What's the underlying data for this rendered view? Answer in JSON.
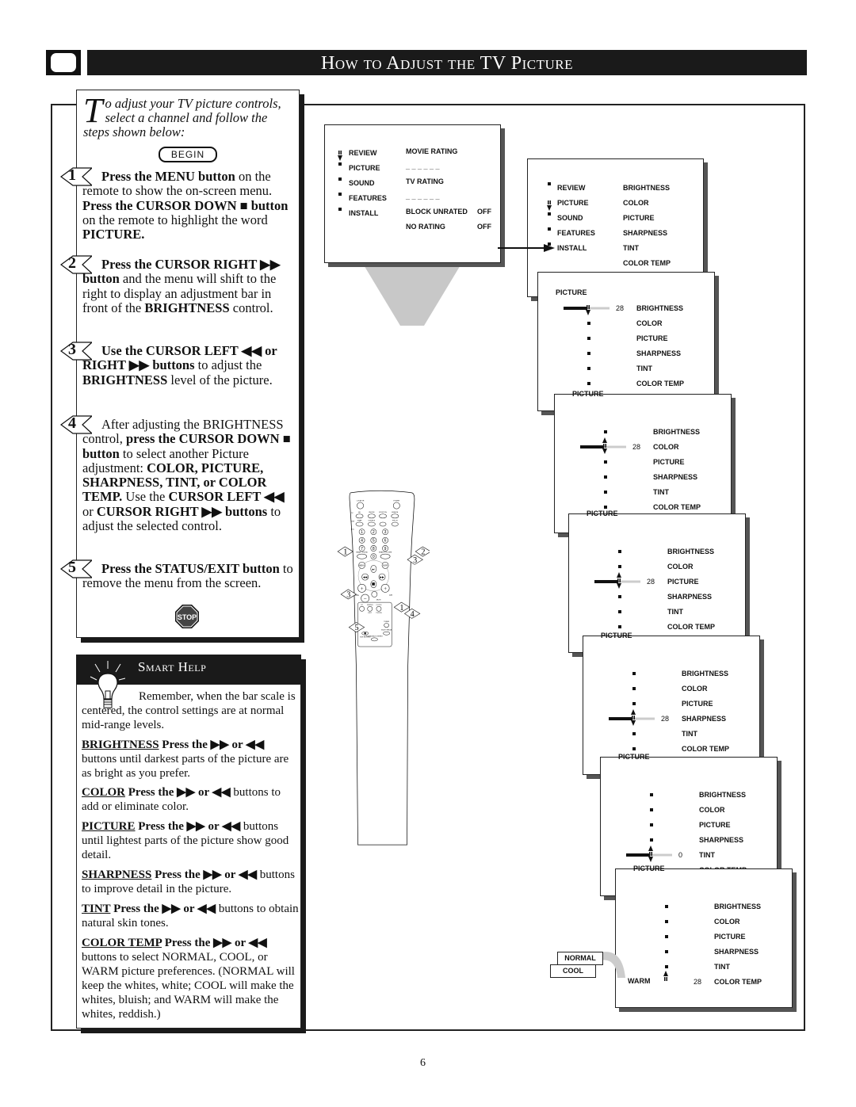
{
  "header": {
    "title": "How to Adjust the TV Picture",
    "icon": "tv-icon"
  },
  "intro": {
    "drop_cap": "T",
    "text": "o adjust your TV picture controls, select a channel and follow the steps shown below:",
    "begin_label": "BEGIN"
  },
  "steps": [
    {
      "num": "1",
      "parts": [
        {
          "b": "Press the MENU button"
        },
        {
          "t": " on the remote to show the on-screen menu. "
        },
        {
          "b": "Press the CURSOR DOWN ■ button"
        },
        {
          "t": " on the remote to highlight the word "
        },
        {
          "b": "PICTURE."
        }
      ]
    },
    {
      "num": "2",
      "parts": [
        {
          "b": "Press the CURSOR RIGHT ▶▶ button"
        },
        {
          "t": " and the menu will shift to the right to display an adjustment bar in front of the "
        },
        {
          "b": "BRIGHTNESS"
        },
        {
          "t": " control."
        }
      ]
    },
    {
      "num": "3",
      "parts": [
        {
          "b": "Use the CURSOR LEFT ◀◀ or RIGHT ▶▶ buttons"
        },
        {
          "t": " to adjust the "
        },
        {
          "b": "BRIGHTNESS"
        },
        {
          "t": " level of the picture."
        }
      ]
    },
    {
      "num": "4",
      "parts": [
        {
          "t": "After adjusting the BRIGHTNESS control, "
        },
        {
          "b": "press the CURSOR DOWN ■ button"
        },
        {
          "t": " to select another Picture adjustment: "
        },
        {
          "b": "COLOR, PICTURE, SHARPNESS, TINT, or COLOR TEMP."
        },
        {
          "t": " Use the "
        },
        {
          "b": "CURSOR LEFT ◀◀"
        },
        {
          "t": " or "
        },
        {
          "b": "CURSOR RIGHT ▶▶ buttons"
        },
        {
          "t": " to adjust the selected control."
        }
      ]
    },
    {
      "num": "5",
      "parts": [
        {
          "b": "Press the STATUS/EXIT button"
        },
        {
          "t": " to remove the menu from the screen."
        }
      ]
    }
  ],
  "stop_label": "STOP",
  "smart_help": {
    "title": "Smart Help",
    "intro": "Remember, when the bar scale is centered, the control settings are at normal mid-range levels.",
    "items": [
      {
        "term": "BRIGHTNESS",
        "lead": "Press the ▶▶ or ◀◀",
        "text": " buttons until darkest parts of the picture are as bright as you prefer."
      },
      {
        "term": "COLOR",
        "lead": "Press the ▶▶ or ◀◀",
        "text": " buttons to add or eliminate color."
      },
      {
        "term": "PICTURE",
        "lead": "Press the ▶▶ or ◀◀",
        "text": " buttons until lightest parts of the picture show good detail."
      },
      {
        "term": "SHARPNESS",
        "lead": "Press the ▶▶ or ◀◀",
        "text": " buttons to improve detail in the picture."
      },
      {
        "term": "TINT",
        "lead": "Press the ▶▶ or ◀◀",
        "text": " buttons to obtain natural skin tones."
      },
      {
        "term": "COLOR TEMP",
        "lead": "Press the ▶▶ or ◀◀",
        "text": " buttons to select NORMAL, COOL, or WARM picture preferences. (NORMAL will keep the whites, white; COOL will make the whites, bluish; and WARM will make the whites, reddish.)"
      }
    ]
  },
  "main_menu": {
    "items": [
      "REVIEW",
      "PICTURE",
      "SOUND",
      "FEATURES",
      "INSTALL"
    ],
    "review_values": [
      [
        "MOVIE RATING",
        ""
      ],
      [
        "_ _ _ _ _ _",
        ""
      ],
      [
        "TV RATING",
        ""
      ],
      [
        "_ _ _ _ _ _",
        ""
      ],
      [
        "BLOCK UNRATED",
        "OFF"
      ],
      [
        "NO RATING",
        "OFF"
      ]
    ],
    "picture_values": [
      "BRIGHTNESS",
      "COLOR",
      "PICTURE",
      "SHARPNESS",
      "TINT",
      "COLOR TEMP"
    ]
  },
  "picture_menu": {
    "heading": "PICTURE",
    "controls": [
      "BRIGHTNESS",
      "COLOR",
      "PICTURE",
      "SHARPNESS",
      "TINT",
      "COLOR TEMP"
    ],
    "screens": [
      {
        "active": 0,
        "value": "28",
        "level": 0.5
      },
      {
        "active": 1,
        "value": "28",
        "level": 0.5
      },
      {
        "active": 2,
        "value": "28",
        "level": 0.5
      },
      {
        "active": 3,
        "value": "28",
        "level": 0.5
      },
      {
        "active": 4,
        "value": "0",
        "level": 0.5
      },
      {
        "active": 5,
        "value": "28",
        "level": null
      }
    ],
    "color_temp_options": [
      "NORMAL",
      "COOL",
      "WARM"
    ]
  },
  "remote": {
    "labels": {
      "locator": "LOCATOR",
      "power": "POWER",
      "tv": "TV",
      "vcr": "VCR",
      "acc": "ACC",
      "av": "AV",
      "onoff": "ON/OFF",
      "position": "POSITION",
      "freeze": "FREEZE",
      "swap": "SWAP",
      "source": "SOURCE",
      "pipch": "PIP CH",
      "up": "UP",
      "dn": "DN",
      "smart_sound": "SMART SOUND",
      "smart_picture": "SMART PICTURE",
      "menu": "MENU",
      "surf": "SURF",
      "vol": "VOL",
      "ch": "CH",
      "mute": "MUTE",
      "cc": "CC",
      "status": "STATUS",
      "exit": "EXIT",
      "clock": "CLOCK",
      "tvvcr": "TV/VCR",
      "tuner": "TUNER",
      "ab": "A/B",
      "vcr_record": "VCR RECORD",
      "multi": "MULTI MEDIA",
      "incredible": "INCREDIBLE STEREO"
    },
    "digits": [
      "1",
      "2",
      "3",
      "4",
      "5",
      "6",
      "7",
      "8",
      "9",
      "0"
    ],
    "callouts": [
      "1",
      "2",
      "3",
      "3",
      "1",
      "4",
      "5"
    ]
  },
  "page_number": "6"
}
